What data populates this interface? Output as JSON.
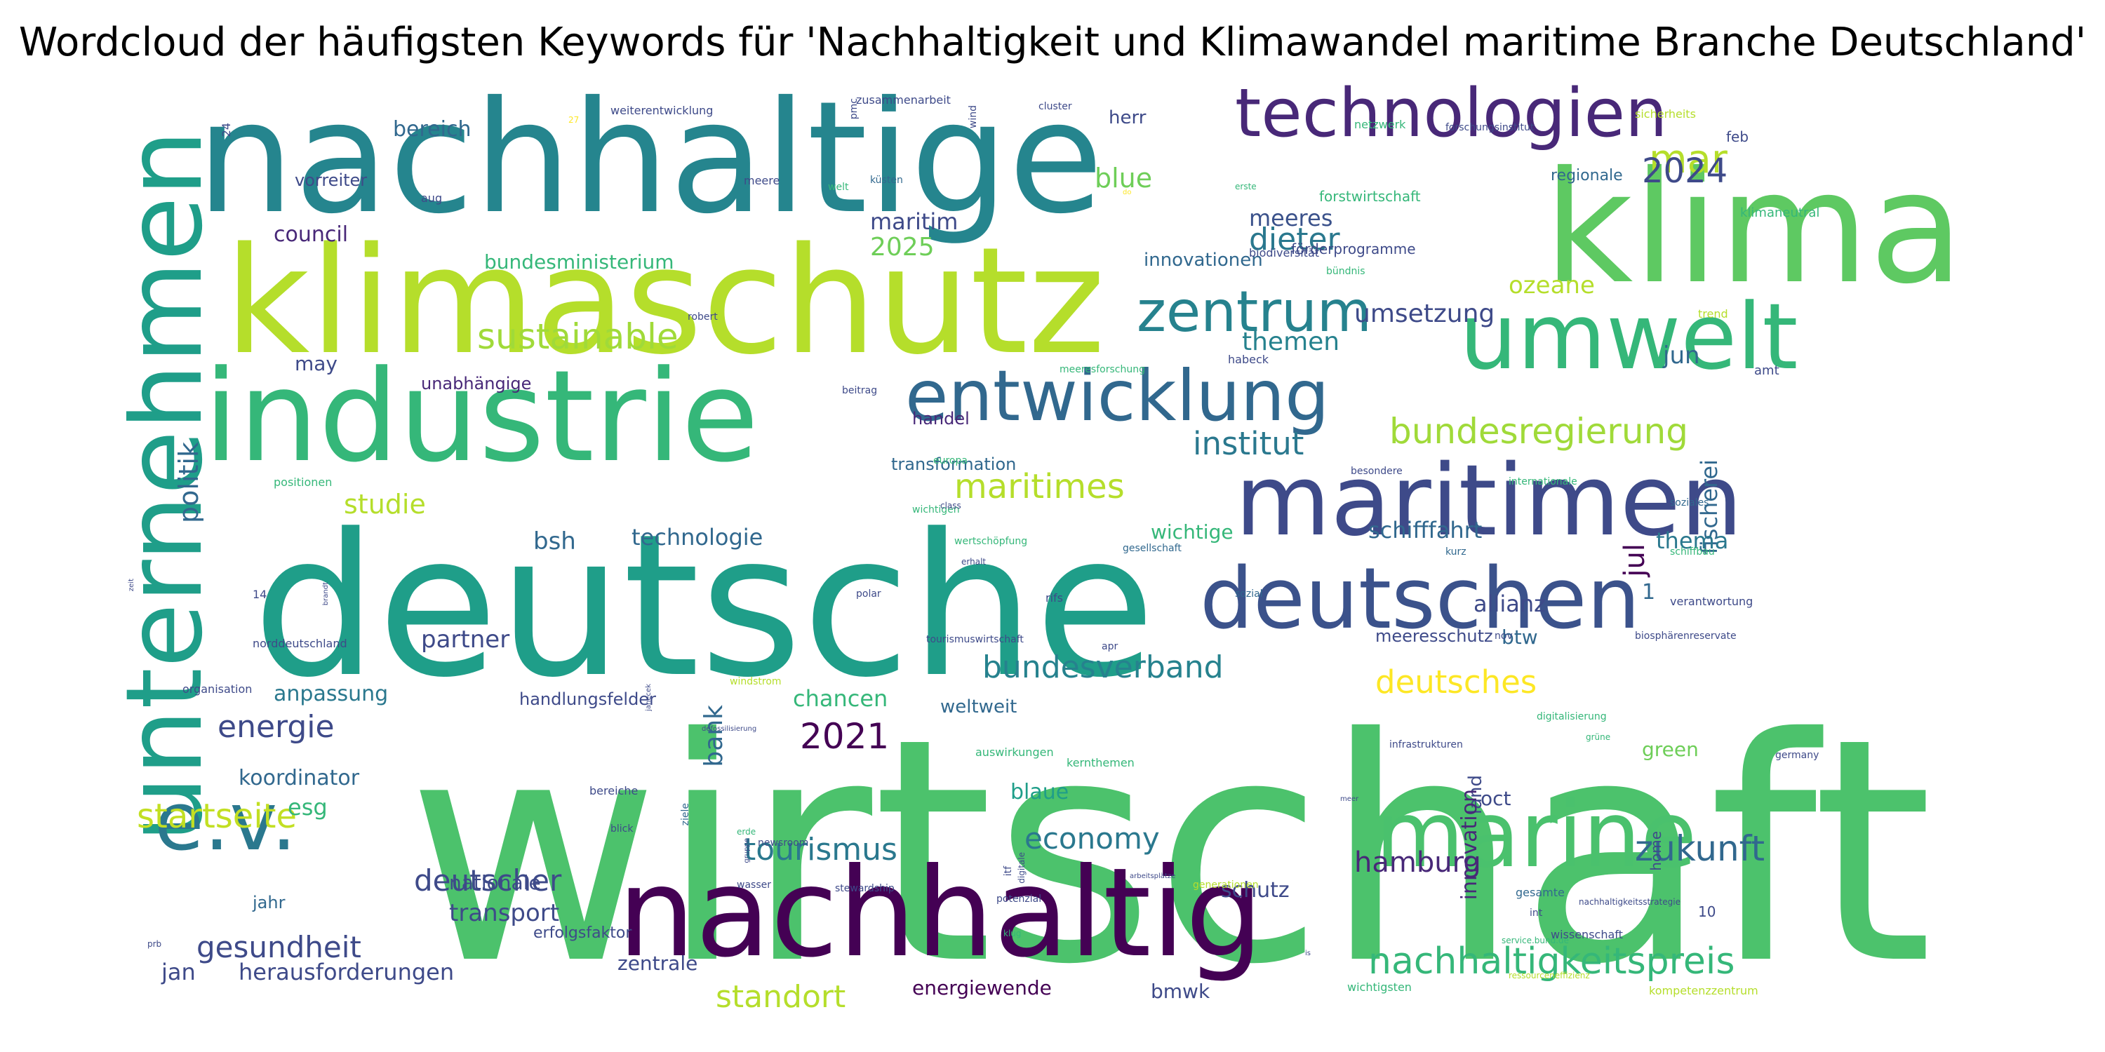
{
  "title": "Wordcloud der häufigsten Keywords für 'Nachhaltigkeit und Klimawandel maritime Branche Deutschland'",
  "colors": {
    "background": "#ffffff",
    "palette": [
      "#440154",
      "#482878",
      "#3e4a89",
      "#31688e",
      "#26828e",
      "#1f9e89",
      "#35b779",
      "#6ece58",
      "#b5de2b",
      "#fde725"
    ]
  },
  "words": [
    {
      "text": "wirtschaft",
      "weight": 100,
      "color": "#4cc26c"
    },
    {
      "text": "deutsche",
      "weight": 80,
      "color": "#1f9e89"
    },
    {
      "text": "nachhaltige",
      "weight": 66,
      "color": "#25858e"
    },
    {
      "text": "klima",
      "weight": 66,
      "color": "#5ec962"
    },
    {
      "text": "klimaschutz",
      "weight": 62,
      "color": "#b5de2b"
    },
    {
      "text": "industrie",
      "weight": 52,
      "color": "#35b779"
    },
    {
      "text": "nachhaltig",
      "weight": 50,
      "color": "#440154"
    },
    {
      "text": "unternehmen",
      "weight": 44,
      "color": "#1f9e89"
    },
    {
      "text": "maritimen",
      "weight": 38,
      "color": "#3e4a89"
    },
    {
      "text": "umwelt",
      "weight": 38,
      "color": "#35b779"
    },
    {
      "text": "marine",
      "weight": 38,
      "color": "#4ac16d"
    },
    {
      "text": "deutschen",
      "weight": 32,
      "color": "#3b528b"
    },
    {
      "text": "e.v.",
      "weight": 32,
      "color": "#2a788e"
    },
    {
      "text": "entwicklung",
      "weight": 28,
      "color": "#31688e"
    },
    {
      "text": "technologien",
      "weight": 26,
      "color": "#482878"
    },
    {
      "text": "zentrum",
      "weight": 20,
      "color": "#26828e"
    },
    {
      "text": "nachhaltigkeitspreis",
      "weight": 15,
      "color": "#35b779"
    },
    {
      "text": "mar",
      "weight": 15,
      "color": "#b5de2b"
    },
    {
      "text": "2024",
      "weight": 13,
      "color": "#3e4a89"
    },
    {
      "text": "sustainable",
      "weight": 12,
      "color": "#a0da39"
    },
    {
      "text": "dieter",
      "weight": 11,
      "color": "#2a788e"
    },
    {
      "text": "bundesregierung",
      "weight": 12,
      "color": "#a0da39"
    },
    {
      "text": "maritimes",
      "weight": 12,
      "color": "#b5de2b"
    },
    {
      "text": "institut",
      "weight": 12,
      "color": "#2a788e"
    },
    {
      "text": "deutsches",
      "weight": 11,
      "color": "#fde725"
    },
    {
      "text": "bundesverband",
      "weight": 12,
      "color": "#26828e"
    },
    {
      "text": "startseite",
      "weight": 13,
      "color": "#c2df23"
    },
    {
      "text": "gesundheit",
      "weight": 10,
      "color": "#3e4a89"
    },
    {
      "text": "zukunft",
      "weight": 13,
      "color": "#31688e"
    },
    {
      "text": "economy",
      "weight": 11,
      "color": "#2a788e"
    },
    {
      "text": "tourismus",
      "weight": 12,
      "color": "#2a788e"
    },
    {
      "text": "standort",
      "weight": 11,
      "color": "#b5de2b"
    },
    {
      "text": "2021",
      "weight": 12,
      "color": "#440154"
    },
    {
      "text": "energie",
      "weight": 11,
      "color": "#3e4a89"
    },
    {
      "text": "deutscher",
      "weight": 11,
      "color": "#3e4a89"
    },
    {
      "text": "hamburg",
      "weight": 10,
      "color": "#482878"
    },
    {
      "text": "politik",
      "weight": 10,
      "color": "#31688e"
    },
    {
      "text": "themen",
      "weight": 9,
      "color": "#26828e"
    },
    {
      "text": "umsetzung",
      "weight": 9,
      "color": "#3e4a89"
    },
    {
      "text": "blue",
      "weight": 9,
      "color": "#6ece58"
    },
    {
      "text": "meeres",
      "weight": 8,
      "color": "#3b528b"
    },
    {
      "text": "maritim",
      "weight": 8,
      "color": "#3e4a89"
    },
    {
      "text": "2025",
      "weight": 9,
      "color": "#6ece58"
    },
    {
      "text": "council",
      "weight": 8,
      "color": "#482878"
    },
    {
      "text": "bereich",
      "weight": 8,
      "color": "#31688e"
    },
    {
      "text": "vorreiter",
      "weight": 6,
      "color": "#3e4a89"
    },
    {
      "text": "bundesministerium",
      "weight": 7,
      "color": "#35b779"
    },
    {
      "text": "innovationen",
      "weight": 6,
      "color": "#31688e"
    },
    {
      "text": "studie",
      "weight": 9,
      "color": "#b5de2b"
    },
    {
      "text": "bsh",
      "weight": 8,
      "color": "#31688e"
    },
    {
      "text": "technologie",
      "weight": 8,
      "color": "#31688e"
    },
    {
      "text": "may",
      "weight": 7,
      "color": "#3e4a89"
    },
    {
      "text": "unabhängige",
      "weight": 6,
      "color": "#482878"
    },
    {
      "text": "handel",
      "weight": 6,
      "color": "#482878"
    },
    {
      "text": "transformation",
      "weight": 6,
      "color": "#31688e"
    },
    {
      "text": "wichtige",
      "weight": 7,
      "color": "#35b779"
    },
    {
      "text": "schifffahrt",
      "weight": 8,
      "color": "#31688e"
    },
    {
      "text": "ozeane",
      "weight": 7,
      "color": "#b5de2b"
    },
    {
      "text": "jun",
      "weight": 8,
      "color": "#31688e"
    },
    {
      "text": "fischerei",
      "weight": 8,
      "color": "#31688e"
    },
    {
      "text": "thema",
      "weight": 8,
      "color": "#2a788e"
    },
    {
      "text": "jul",
      "weight": 9,
      "color": "#440154"
    },
    {
      "text": "allianz",
      "weight": 8,
      "color": "#3e4a89"
    },
    {
      "text": "btw",
      "weight": 7,
      "color": "#31688e"
    },
    {
      "text": "partner",
      "weight": 8,
      "color": "#3e4a89"
    },
    {
      "text": "anpassung",
      "weight": 7,
      "color": "#2a788e"
    },
    {
      "text": "handlungsfelder",
      "weight": 6,
      "color": "#3e4a89"
    },
    {
      "text": "weltweit",
      "weight": 6,
      "color": "#31688e"
    },
    {
      "text": "chancen",
      "weight": 8,
      "color": "#35b779"
    },
    {
      "text": "bank",
      "weight": 9,
      "color": "#31688e"
    },
    {
      "text": "meeresschutz",
      "weight": 6,
      "color": "#3e4a89"
    },
    {
      "text": "koordinator",
      "weight": 7,
      "color": "#31688e"
    },
    {
      "text": "esg",
      "weight": 8,
      "color": "#35b779"
    },
    {
      "text": "jahr",
      "weight": 6,
      "color": "#31688e"
    },
    {
      "text": "blaue",
      "weight": 7,
      "color": "#1f9e89"
    },
    {
      "text": "land",
      "weight": 7,
      "color": "#3e4a89"
    },
    {
      "text": "innovation",
      "weight": 7,
      "color": "#482878"
    },
    {
      "text": "oct",
      "weight": 7,
      "color": "#3e4a89"
    },
    {
      "text": "green",
      "weight": 7,
      "color": "#6ece58"
    },
    {
      "text": "nationale",
      "weight": 6,
      "color": "#3e4a89"
    },
    {
      "text": "schutz",
      "weight": 8,
      "color": "#3e4a89"
    },
    {
      "text": "transport",
      "weight": 8,
      "color": "#3e4a89"
    },
    {
      "text": "erfolgsfaktor",
      "weight": 5,
      "color": "#3e4a89"
    },
    {
      "text": "herausforderungen",
      "weight": 7,
      "color": "#3e4a89"
    },
    {
      "text": "zentrale",
      "weight": 7,
      "color": "#3e4a89"
    },
    {
      "text": "jan",
      "weight": 7,
      "color": "#3e4a89"
    },
    {
      "text": "energiewende",
      "weight": 6,
      "color": "#440154"
    },
    {
      "text": "bmwk",
      "weight": 6,
      "color": "#3e4a89"
    },
    {
      "text": "herr",
      "weight": 6,
      "color": "#3e4a89"
    },
    {
      "text": "home",
      "weight": 5,
      "color": "#3e4a89"
    },
    {
      "text": "10",
      "weight": 5,
      "color": "#3e4a89"
    },
    {
      "text": "1",
      "weight": 7,
      "color": "#31688e"
    },
    {
      "text": "feb",
      "weight": 5,
      "color": "#3e4a89"
    },
    {
      "text": "regionale",
      "weight": 5,
      "color": "#31688e"
    },
    {
      "text": "netzwerk",
      "weight": 3,
      "color": "#35b779"
    },
    {
      "text": "sicherheits",
      "weight": 3,
      "color": "#b5de2b"
    },
    {
      "text": "weiterentwicklung",
      "weight": 3,
      "color": "#3e4a89"
    },
    {
      "text": "zusammenarbeit",
      "weight": 2,
      "color": "#3e4a89"
    },
    {
      "text": "cluster",
      "weight": 2,
      "color": "#3e4a89"
    },
    {
      "text": "pmc",
      "weight": 2,
      "color": "#3e4a89"
    },
    {
      "text": "wind",
      "weight": 3,
      "color": "#3e4a89"
    },
    {
      "text": "forschungsinstitut",
      "weight": 4,
      "color": "#3e4a89"
    },
    {
      "text": "forstwirtschaft",
      "weight": 4,
      "color": "#35b779"
    },
    {
      "text": "förderprogramme",
      "weight": 4,
      "color": "#3e4a89"
    },
    {
      "text": "klimaneutral",
      "weight": 3,
      "color": "#35b779"
    },
    {
      "text": "bündnis",
      "weight": 3,
      "color": "#35b779"
    },
    {
      "text": "biodiversität",
      "weight": 2,
      "color": "#3e4a89"
    },
    {
      "text": "küsten",
      "weight": 3,
      "color": "#31688e"
    },
    {
      "text": "aug",
      "weight": 3,
      "color": "#3e4a89"
    },
    {
      "text": "meere",
      "weight": 3,
      "color": "#3e4a89"
    },
    {
      "text": "welt",
      "weight": 3,
      "color": "#35b779"
    },
    {
      "text": "erste",
      "weight": 3,
      "color": "#35b779"
    },
    {
      "text": "trend",
      "weight": 3,
      "color": "#b5de2b"
    },
    {
      "text": "robert",
      "weight": 3,
      "color": "#3e4a89"
    },
    {
      "text": "beitrag",
      "weight": 3,
      "color": "#3e4a89"
    },
    {
      "text": "meeresforschung",
      "weight": 3,
      "color": "#35b779"
    },
    {
      "text": "habeck",
      "weight": 3,
      "color": "#3e4a89"
    },
    {
      "text": "amt",
      "weight": 3,
      "color": "#3e4a89"
    },
    {
      "text": "europa",
      "weight": 3,
      "color": "#35b779"
    },
    {
      "text": "besondere",
      "weight": 3,
      "color": "#3e4a89"
    },
    {
      "text": "internationale",
      "weight": 3,
      "color": "#35b779"
    },
    {
      "text": "soziales",
      "weight": 3,
      "color": "#31688e"
    },
    {
      "text": "positionen",
      "weight": 3,
      "color": "#35b779"
    },
    {
      "text": "wichtigen",
      "weight": 3,
      "color": "#35b779"
    },
    {
      "text": "wertschöpfung",
      "weight": 3,
      "color": "#35b779"
    },
    {
      "text": "gesellschaft",
      "weight": 3,
      "color": "#31688e"
    },
    {
      "text": "kurz",
      "weight": 3,
      "color": "#31688e"
    },
    {
      "text": "schiffbau",
      "weight": 2,
      "color": "#35b779"
    },
    {
      "text": "erhalt",
      "weight": 3,
      "color": "#3e4a89"
    },
    {
      "text": "sozial",
      "weight": 3,
      "color": "#31688e"
    },
    {
      "text": "14",
      "weight": 3,
      "color": "#3e4a89"
    },
    {
      "text": "polar",
      "weight": 3,
      "color": "#3e4a89"
    },
    {
      "text": "rifs",
      "weight": 3,
      "color": "#3e4a89"
    },
    {
      "text": "verantwortung",
      "weight": 3,
      "color": "#3e4a89"
    },
    {
      "text": "norddeutschland",
      "weight": 3,
      "color": "#3e4a89"
    },
    {
      "text": "tourismuswirtschaft",
      "weight": 3,
      "color": "#3e4a89"
    },
    {
      "text": "apr",
      "weight": 3,
      "color": "#3e4a89"
    },
    {
      "text": "nov",
      "weight": 3,
      "color": "#3e4a89"
    },
    {
      "text": "biosphärenreservate",
      "weight": 3,
      "color": "#3e4a89"
    },
    {
      "text": "organisation",
      "weight": 3,
      "color": "#3e4a89"
    },
    {
      "text": "windstrom",
      "weight": 3,
      "color": "#b5de2b"
    },
    {
      "text": "auswirkungen",
      "weight": 3,
      "color": "#35b779"
    },
    {
      "text": "infrastrukturen",
      "weight": 2,
      "color": "#3e4a89"
    },
    {
      "text": "digitalisierung",
      "weight": 3,
      "color": "#35b779"
    },
    {
      "text": "kernthemen",
      "weight": 3,
      "color": "#35b779"
    },
    {
      "text": "grüne",
      "weight": 3,
      "color": "#35b779"
    },
    {
      "text": "germany",
      "weight": 2,
      "color": "#3e4a89"
    },
    {
      "text": "bereiche",
      "weight": 3,
      "color": "#3e4a89"
    },
    {
      "text": "newsroom",
      "weight": 3,
      "color": "#3e4a89"
    },
    {
      "text": "erde",
      "weight": 3,
      "color": "#35b779"
    },
    {
      "text": "ziele",
      "weight": 3,
      "color": "#31688e"
    },
    {
      "text": "blick",
      "weight": 3,
      "color": "#3e4a89"
    },
    {
      "text": "wasser",
      "weight": 3,
      "color": "#3e4a89"
    },
    {
      "text": "stewardship",
      "weight": 3,
      "color": "#3e4a89"
    },
    {
      "text": "potenzial",
      "weight": 3,
      "color": "#3e4a89"
    },
    {
      "text": "gesamte",
      "weight": 3,
      "color": "#31688e"
    },
    {
      "text": "int",
      "weight": 2,
      "color": "#3e4a89"
    },
    {
      "text": "wissenschaft",
      "weight": 2,
      "color": "#3e4a89"
    },
    {
      "text": "nachhaltigkeitsstrategie",
      "weight": 3,
      "color": "#3e4a89"
    },
    {
      "text": "service.bund.de",
      "weight": 2,
      "color": "#35b779"
    },
    {
      "text": "wichtigsten",
      "weight": 3,
      "color": "#35b779"
    },
    {
      "text": "ressourceneffizienz",
      "weight": 2,
      "color": "#b5de2b"
    },
    {
      "text": "kompetenzzentrum",
      "weight": 2,
      "color": "#b5de2b"
    },
    {
      "text": "prb",
      "weight": 2,
      "color": "#3e4a89"
    },
    {
      "text": "gruppe",
      "weight": 1,
      "color": "#3e4a89"
    },
    {
      "text": "klug",
      "weight": 2,
      "color": "#35b779"
    },
    {
      "text": "janecek",
      "weight": 2,
      "color": "#3e4a89"
    },
    {
      "text": "itf",
      "weight": 2,
      "color": "#3e4a89"
    },
    {
      "text": "digitale",
      "weight": 1,
      "color": "#3e4a89"
    },
    {
      "text": "generationen",
      "weight": 1,
      "color": "#b5de2b"
    },
    {
      "text": "meer",
      "weight": 1,
      "color": "#3e4a89"
    },
    {
      "text": "defossilisierung",
      "weight": 1,
      "color": "#3e4a89"
    },
    {
      "text": "is",
      "weight": 1,
      "color": "#3e4a89"
    },
    {
      "text": "arbeitsplätze",
      "weight": 1,
      "color": "#3e4a89"
    },
    {
      "text": "brandt",
      "weight": 1,
      "color": "#3e4a89"
    },
    {
      "text": "zeit",
      "weight": 1,
      "color": "#3e4a89"
    },
    {
      "text": "a¹",
      "weight": 1,
      "color": "#3e4a89"
    },
    {
      "text": "27",
      "weight": 1,
      "color": "#fde725"
    },
    {
      "text": "24",
      "weight": 1,
      "color": "#3e4a89"
    },
    {
      "text": "of",
      "weight": 1,
      "color": "#3e4a89"
    },
    {
      "text": "class",
      "weight": 1,
      "color": "#3e4a89"
    },
    {
      "text": "do",
      "weight": 1,
      "color": "#fde725"
    }
  ]
}
